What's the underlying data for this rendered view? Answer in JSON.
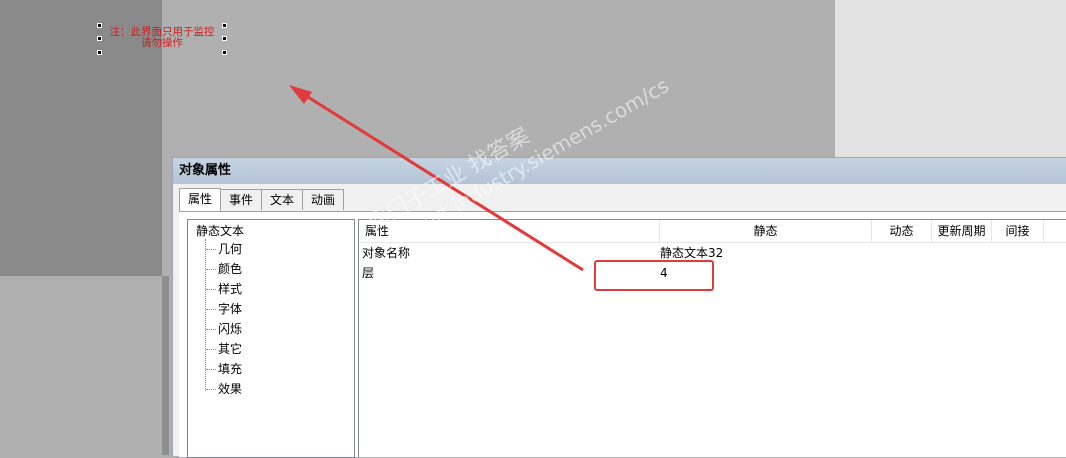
{
  "canvas": {
    "note_lines": [
      "注：此界面只用于监控",
      "请勿操作"
    ]
  },
  "dialog": {
    "title": "对象属性",
    "tabs": [
      {
        "label": "属性",
        "active": true
      },
      {
        "label": "事件"
      },
      {
        "label": "文本"
      },
      {
        "label": "动画"
      }
    ],
    "tree": {
      "root": "静态文本",
      "items": [
        "几何",
        "颜色",
        "样式",
        "字体",
        "闪烁",
        "其它",
        "填充",
        "效果"
      ]
    },
    "grid": {
      "columns": [
        "属性",
        "静态",
        "动态",
        "更新周期",
        "间接"
      ],
      "rows": [
        {
          "property": "对象名称",
          "static": "静态文本32"
        },
        {
          "property": "层",
          "static": "4"
        }
      ]
    }
  },
  "watermark": {
    "line1": "西门子工业 找答案",
    "line2": "support.industry.siemens.com/cs"
  },
  "colors": {
    "annotation_red": "#e23a3a",
    "note_text": "#d21c1c",
    "title_bar": "#b9c9da"
  }
}
